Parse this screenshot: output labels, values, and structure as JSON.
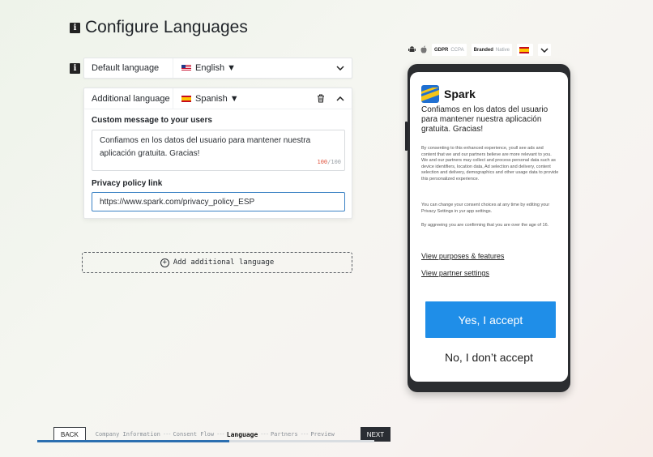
{
  "page": {
    "title": "Configure Languages"
  },
  "default_language": {
    "label": "Default language",
    "value": "English ▼"
  },
  "additional_language": {
    "label": "Additional language",
    "value": "Spanish ▼",
    "custom_message_label": "Custom message to your users",
    "custom_message": "Confiamos en los datos del usuario para mantener nuestra aplicación gratuita. Gracias!",
    "char_count": "100",
    "char_limit": "/100",
    "privacy_label": "Privacy policy link",
    "privacy_url": "https://www.spark.com/privacy_policy_ESP"
  },
  "add_language": {
    "label": "Add additional language"
  },
  "nav": {
    "back": "BACK",
    "next": "NEXT",
    "steps": [
      "Company Information",
      "Consent Flow",
      "Language",
      "Partners",
      "Preview"
    ],
    "active_step": "Language",
    "progress_percent": 57
  },
  "preview_toolbar": {
    "gdpr": "GDPR",
    "ccpa": "CCPA",
    "branded": "Branded",
    "native": "Native"
  },
  "phone": {
    "brand": "Spark",
    "headline": "Confiamos en los datos del usuario para mantener nuestra aplicación gratuita. Gracias!",
    "body_1": "By consenting to this enhanced experience, youll see ads and content that we and our partners believe are more relevant to you. We and our partners may collect and process personal data such as device identifiers, location data, Ad selection and delivery, content selection and delivery, demographics and other usage data to provide this personalized experience.",
    "body_2": "You can change your consent choices at any time by editing your Privacy Settings in yur app settings.",
    "body_3": "By aggreeing you are confirming that you are over the age of 16.",
    "link_purposes": "View purposes & features",
    "link_partners": "View partner settings",
    "accept": "Yes, I accept",
    "decline": "No, I don’t accept"
  },
  "colors": {
    "accent": "#1f8ee8",
    "progress": "#2c6fb0",
    "counter_current": "#e0533d"
  }
}
